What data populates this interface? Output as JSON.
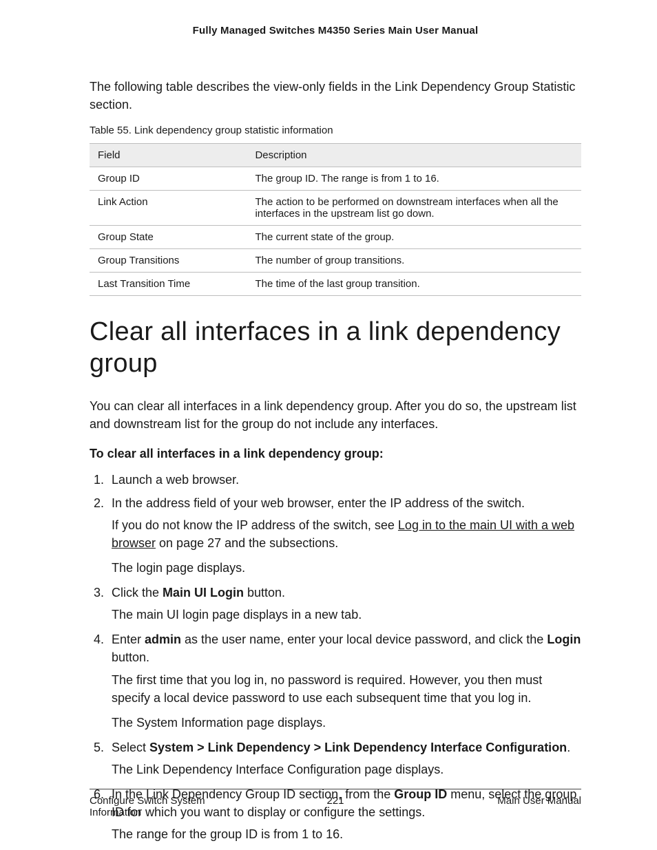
{
  "header": {
    "title": "Fully Managed Switches M4350 Series Main User Manual"
  },
  "intro": "The following table describes the view-only fields in the Link Dependency Group Statistic section.",
  "table": {
    "caption": "Table 55. Link dependency group statistic information",
    "head": {
      "c1": "Field",
      "c2": "Description"
    },
    "rows": [
      {
        "c1": "Group ID",
        "c2": "The group ID. The range is from 1 to 16."
      },
      {
        "c1": "Link Action",
        "c2": "The action to be performed on downstream interfaces when all the interfaces in the upstream list go down."
      },
      {
        "c1": "Group State",
        "c2": "The current state of the group."
      },
      {
        "c1": "Group Transitions",
        "c2": "The number of group transitions."
      },
      {
        "c1": "Last Transition Time",
        "c2": "The time of the last group transition."
      }
    ]
  },
  "section": {
    "title": "Clear all interfaces in a link dependency group",
    "lead": "You can clear all interfaces in a link dependency group. After you do so, the upstream list and downstream list for the group do not include any interfaces.",
    "procedure_title": "To clear all interfaces in a link dependency group:"
  },
  "steps": {
    "s1": "Launch a web browser.",
    "s2": "In the address field of your web browser, enter the IP address of the switch.",
    "s2_a_pre": "If you do not know the IP address of the switch, see ",
    "s2_a_link": "Log in to the main UI with a web browser",
    "s2_a_post": " on page 27 and the subsections.",
    "s2_b": "The login page displays.",
    "s3_pre": "Click the ",
    "s3_bold": "Main UI Login",
    "s3_post": " button.",
    "s3_a": "The main UI login page displays in a new tab.",
    "s4_pre": "Enter ",
    "s4_bold1": "admin",
    "s4_mid": " as the user name, enter your local device password, and click the ",
    "s4_bold2": "Login",
    "s4_post": " button.",
    "s4_a": "The first time that you log in, no password is required. However, you then must specify a local device password to use each subsequent time that you log in.",
    "s4_b": "The System Information page displays.",
    "s5_pre": "Select ",
    "s5_bold": "System > Link Dependency > Link Dependency Interface Configuration",
    "s5_post": ".",
    "s5_a": "The Link Dependency Interface Configuration page displays.",
    "s6_pre": "In the Link Dependency Group ID section, from the ",
    "s6_bold": "Group ID",
    "s6_post": " menu, select the group ID for which you want to display or configure the settings.",
    "s6_a": "The range for the group ID is from 1 to 16."
  },
  "footer": {
    "left": "Configure Switch System Information",
    "center": "221",
    "right": "Main User Manual"
  }
}
